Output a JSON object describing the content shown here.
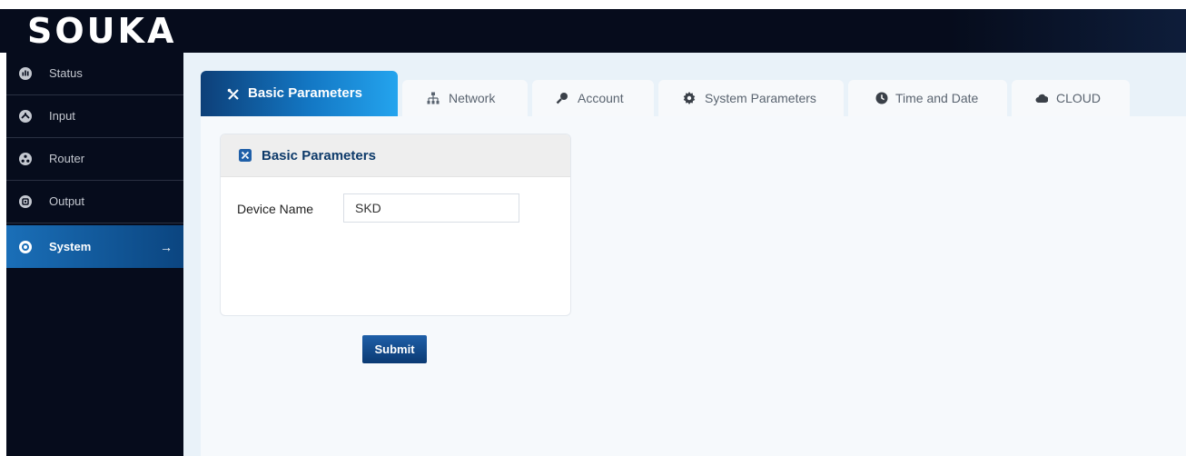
{
  "brand": {
    "logo_text": "SOUKA"
  },
  "sidebar": {
    "items": [
      {
        "label": "Status",
        "icon": "status-icon"
      },
      {
        "label": "Input",
        "icon": "input-icon"
      },
      {
        "label": "Router",
        "icon": "router-icon"
      },
      {
        "label": "Output",
        "icon": "output-icon"
      },
      {
        "label": "System",
        "icon": "system-icon",
        "active": true,
        "arrow": "→"
      }
    ]
  },
  "tabs": [
    {
      "label": "Basic Parameters",
      "icon": "tools-icon",
      "active": true
    },
    {
      "label": "Network",
      "icon": "network-icon"
    },
    {
      "label": "Account",
      "icon": "key-icon"
    },
    {
      "label": "System Parameters",
      "icon": "gear-icon"
    },
    {
      "label": "Time and Date",
      "icon": "clock-icon"
    },
    {
      "label": "CLOUD",
      "icon": "cloud-icon"
    }
  ],
  "panel": {
    "title": "Basic Parameters",
    "title_icon": "tools-icon",
    "fields": [
      {
        "label": "Device Name",
        "value": "SKD"
      }
    ]
  },
  "actions": {
    "submit_label": "Submit"
  },
  "colors": {
    "sidebar_bg": "#060c1c",
    "active_accent": "#1a6fb8",
    "panel_title": "#0d3a6a",
    "main_bg": "#e9f2f9"
  }
}
